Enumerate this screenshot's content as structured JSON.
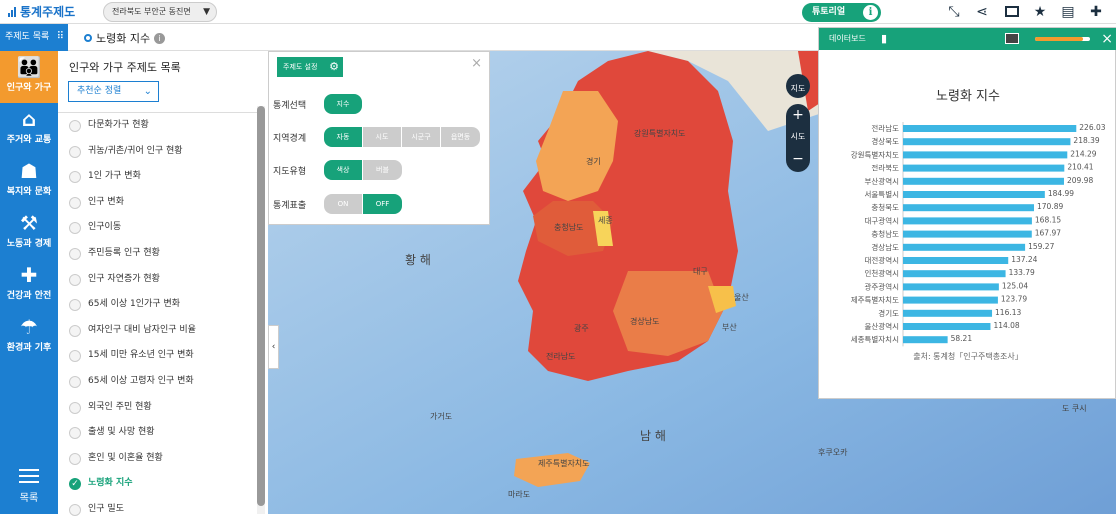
{
  "topbar": {
    "app_title": "통계주제도",
    "region": "전라북도 부안군 동진면",
    "tutorial": "튜토리얼"
  },
  "subbar": {
    "menu_label": "주제도 목록",
    "page_title": "노령화 지수"
  },
  "nav": [
    {
      "label": "인구와 가구",
      "icon": "people-icon",
      "active": true
    },
    {
      "label": "주거와 교통",
      "icon": "house-car-icon",
      "active": false
    },
    {
      "label": "복지와 문화",
      "icon": "welfare-icon",
      "active": false
    },
    {
      "label": "노동과 경제",
      "icon": "labor-icon",
      "active": false
    },
    {
      "label": "건강과 안전",
      "icon": "health-icon",
      "active": false
    },
    {
      "label": "환경과 기후",
      "icon": "environment-icon",
      "active": false
    }
  ],
  "nav_list_label": "목록",
  "panel": {
    "title": "인구와 가구 주제도 목록",
    "sort": "추천순 정렬",
    "items": [
      "다문화가구 현황",
      "귀농/귀촌/귀어 인구 현황",
      "1인 가구 변화",
      "인구 변화",
      "인구이동",
      "주민등록 인구 현황",
      "인구 자연증가 현황",
      "65세 이상 1인가구 변화",
      "여자인구 대비 남자인구 비율",
      "15세 미만 유소년 인구 변화",
      "65세 이상 고령자 인구 변화",
      "외국인 주민 현황",
      "출생 및 사망 현황",
      "혼인 및 이혼율 현황",
      "노령화 지수",
      "인구 밀도"
    ],
    "selected_index": 14
  },
  "settings": {
    "tag": "주제도 설정",
    "rows": [
      {
        "label": "통계선택",
        "options": [
          "지수"
        ],
        "active": 0
      },
      {
        "label": "지역경계",
        "options": [
          "자동",
          "시도",
          "시군구",
          "읍면동"
        ],
        "active": 0
      },
      {
        "label": "지도유형",
        "options": [
          "색상",
          "버블"
        ],
        "active": 0
      },
      {
        "label": "통계표출",
        "options": [
          "ON",
          "OFF"
        ],
        "active": 1
      }
    ]
  },
  "map": {
    "labels": [
      "황 해",
      "남 해",
      "가거도",
      "제주특별자치도",
      "마라도",
      "울산",
      "부산",
      "경상남도",
      "전라남도",
      "강원특별자치도",
      "충청남도",
      "세종",
      "대구",
      "도 쿠시",
      "후쿠오카",
      "경기",
      "광주"
    ],
    "zoom_level": "시도",
    "sido_button": "지도"
  },
  "dashboard": {
    "header": "데이터보드",
    "title": "노령화 지수",
    "source": "출처: 통계청「인구주택총조사」"
  },
  "chart_data": {
    "type": "bar",
    "orientation": "horizontal",
    "title": "노령화 지수",
    "categories": [
      "전라남도",
      "경상북도",
      "강원특별자치도",
      "전라북도",
      "부산광역시",
      "서울특별시",
      "충청북도",
      "대구광역시",
      "충청남도",
      "경상남도",
      "대전광역시",
      "인천광역시",
      "광주광역시",
      "제주특별자치도",
      "경기도",
      "울산광역시",
      "세종특별자치시"
    ],
    "values": [
      226.03,
      218.39,
      214.29,
      210.41,
      209.98,
      184.99,
      170.89,
      168.15,
      167.97,
      159.27,
      137.24,
      133.79,
      125.04,
      123.79,
      116.13,
      114.08,
      58.21
    ],
    "xlim": [
      0,
      240
    ],
    "color": "#3cb6e3"
  }
}
